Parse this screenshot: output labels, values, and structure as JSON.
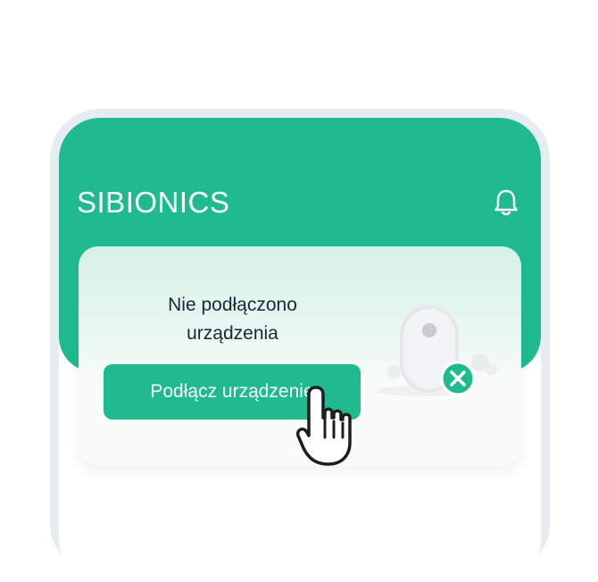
{
  "header": {
    "logo_text": "SIBIONICS",
    "bell_icon": "bell-icon"
  },
  "card": {
    "status_message": "Nie podłączono urządzenia",
    "connect_button_label": "Podłącz urządzenie",
    "device_icon": "sensor-device-icon",
    "disconnected_badge_icon": "x-badge-icon"
  },
  "cursor_icon": "hand-pointer-icon",
  "colors": {
    "brand_green": "#1fbb8f",
    "text_dark": "#1c2733",
    "frame": "#e7ebf2"
  }
}
